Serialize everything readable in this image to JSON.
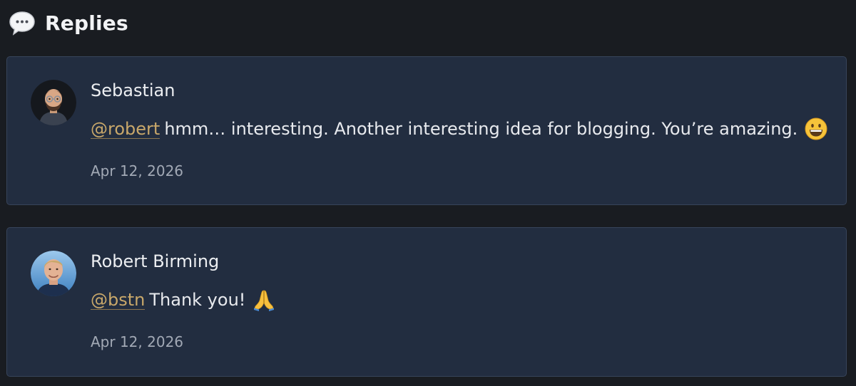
{
  "header": {
    "icon": "speech-bubble-icon",
    "title": "Replies"
  },
  "replies": [
    {
      "author": "Sebastian",
      "avatar": "memoji-avatar",
      "mention": "@robert",
      "text": "hmm… interesting. Another interesting idea for blogging. You’re amazing.",
      "emoji": "grinning-face-emoji",
      "date": "Apr 12, 2026"
    },
    {
      "author": "Robert Birming",
      "avatar": "photo-avatar",
      "mention": "@bstn",
      "text": "Thank you!",
      "emoji": "folded-hands-emoji",
      "date": "Apr 12, 2026"
    }
  ],
  "colors": {
    "background": "#191c21",
    "card": "#222d40",
    "card_border": "#37445a",
    "mention": "#c9a86a",
    "date": "#a2a9b5"
  }
}
